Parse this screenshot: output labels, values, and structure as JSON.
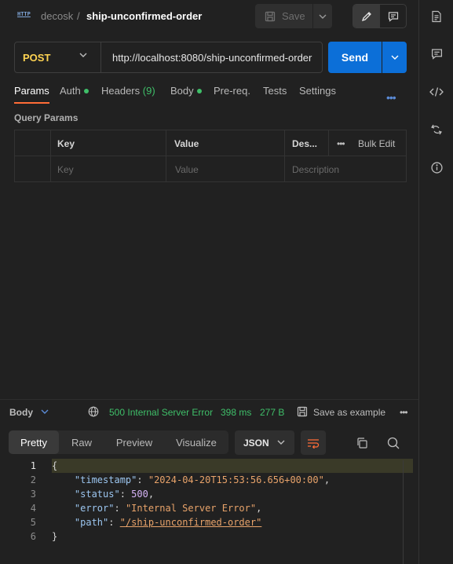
{
  "breadcrumb": {
    "workspace": "decosk",
    "separator": "/",
    "request_name": "ship-unconfirmed-order"
  },
  "http_icon_label": "HTTP",
  "toolbar": {
    "save_label": "Save"
  },
  "request": {
    "method": "POST",
    "url": "http://localhost:8080/ship-unconfirmed-order",
    "send_label": "Send"
  },
  "tabs": [
    {
      "label": "Params",
      "active": true
    },
    {
      "label": "Auth",
      "dot": true
    },
    {
      "label": "Headers",
      "count": "(9)"
    },
    {
      "label": "Body",
      "dot": true
    },
    {
      "label": "Pre-req."
    },
    {
      "label": "Tests"
    },
    {
      "label": "Settings"
    }
  ],
  "more_label": "•••",
  "query_params": {
    "title": "Query Params",
    "headers": {
      "key": "Key",
      "value": "Value",
      "description": "Des...",
      "bulk_edit": "Bulk Edit"
    },
    "placeholders": {
      "key": "Key",
      "value": "Value",
      "description": "Description"
    }
  },
  "response": {
    "body_label": "Body",
    "status": "500 Internal Server Error",
    "time": "398 ms",
    "size": "277 B",
    "save_example": "Save as example",
    "more": "•••",
    "format_tabs": [
      "Pretty",
      "Raw",
      "Preview",
      "Visualize"
    ],
    "format": "JSON",
    "code_lines": [
      "1",
      "2",
      "3",
      "4",
      "5",
      "6"
    ],
    "json": {
      "open": "{",
      "close": "}",
      "timestamp_key": "\"timestamp\"",
      "timestamp_val": "\"2024-04-20T15:53:56.656+00:00\"",
      "status_key": "\"status\"",
      "status_val": "500",
      "error_key": "\"error\"",
      "error_val": "\"Internal Server Error\"",
      "path_key": "\"path\"",
      "path_val": "\"/ship-unconfirmed-order\""
    }
  },
  "colors": {
    "accent": "#ff6c37",
    "send": "#0c6fd8",
    "method": "#ffd452",
    "success": "#3fbf69"
  }
}
